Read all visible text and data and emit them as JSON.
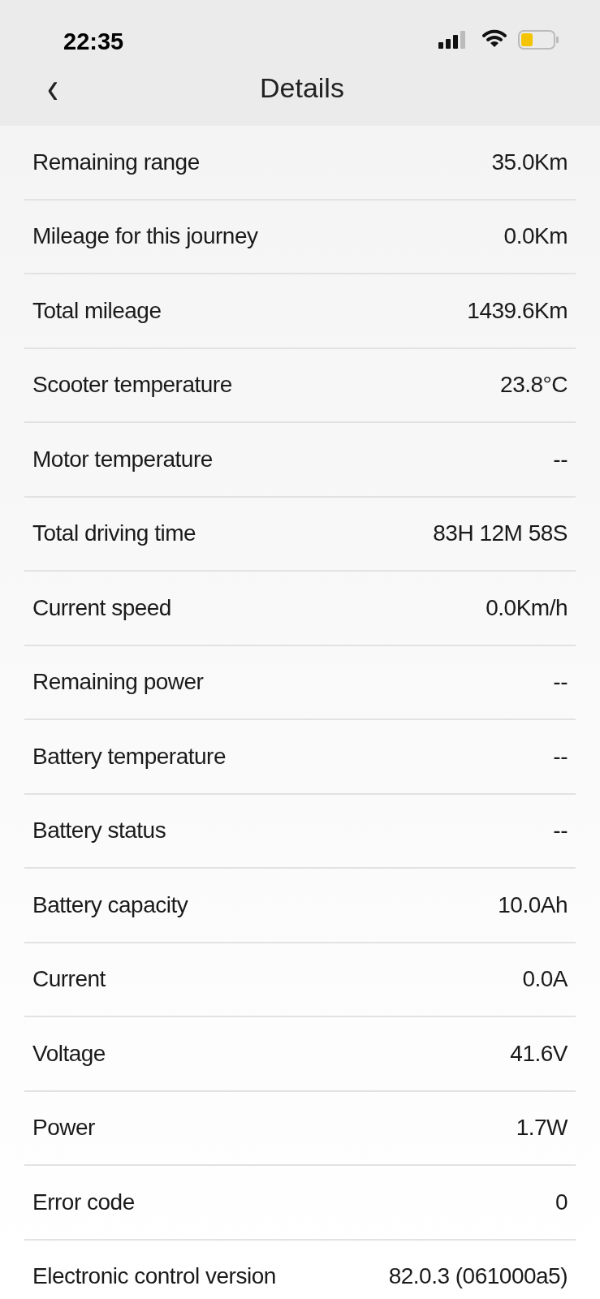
{
  "status_bar": {
    "time": "22:35"
  },
  "header": {
    "back": "‹",
    "title": "Details"
  },
  "rows": [
    {
      "label": "Remaining range",
      "value": "35.0Km"
    },
    {
      "label": "Mileage for this journey",
      "value": "0.0Km"
    },
    {
      "label": "Total mileage",
      "value": "1439.6Km"
    },
    {
      "label": "Scooter temperature",
      "value": "23.8°C"
    },
    {
      "label": "Motor temperature",
      "value": "--"
    },
    {
      "label": "Total driving time",
      "value": "83H 12M 58S"
    },
    {
      "label": "Current speed",
      "value": "0.0Km/h"
    },
    {
      "label": "Remaining power",
      "value": "--"
    },
    {
      "label": "Battery temperature",
      "value": "--"
    },
    {
      "label": "Battery status",
      "value": "--"
    },
    {
      "label": "Battery capacity",
      "value": "10.0Ah"
    },
    {
      "label": "Current",
      "value": "0.0A"
    },
    {
      "label": "Voltage",
      "value": "41.6V"
    },
    {
      "label": "Power",
      "value": "1.7W"
    },
    {
      "label": "Error code",
      "value": "0"
    },
    {
      "label": "Electronic control version",
      "value": "82.0.3 (061000a5)"
    }
  ]
}
